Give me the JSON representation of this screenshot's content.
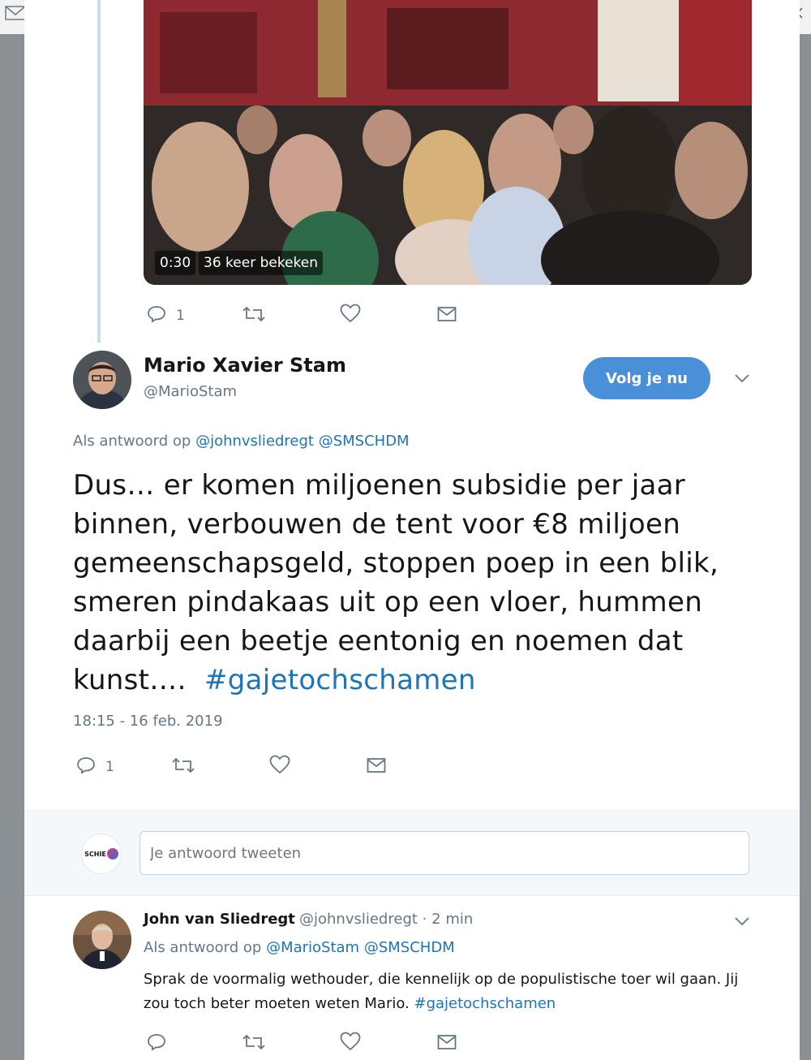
{
  "main_tweet": {
    "author_name": "Mario Xavier Stam",
    "author_handle": "@MarioStam",
    "follow_label": "Volg je nu",
    "reply_prefix": "Als antwoord op",
    "reply_mentions": "@johnvsliedregt @SMSCHDM",
    "text": "Dus… er komen miljoenen subsidie per jaar binnen, verbouwen de tent voor €8 miljoen gemeenschapsgeld, stoppen poep in een blik, smeren pindakaas uit op een vloer, hummen daarbij een beetje eentonig en noemen dat kunst….",
    "hashtag": "#gajetochschamen",
    "timestamp": "18:15 - 16 feb. 2019",
    "reply_count": "1"
  },
  "video_tweet": {
    "duration": "0:30",
    "views": "36 keer bekeken",
    "reply_count": "1"
  },
  "reply_box": {
    "placeholder": "Je antwoord tweeten",
    "avatar_label": "SCHIE"
  },
  "reply_tweet": {
    "author_name": "John van Sliedregt",
    "author_handle": "@johnvsliedregt",
    "separator": "·",
    "time_ago": "2 min",
    "reply_prefix": "Als antwoord op",
    "mention_1": "@MarioStam",
    "mention_2": "@SMSCHDM",
    "text": "Sprak de voormalig wethouder, die kennelijk op de populistische toer wil gaan. Jij zou toch beter moeten weten Mario.",
    "hashtag": "#gajetochschamen"
  },
  "icons": [
    "reply-icon",
    "retweet-icon",
    "like-icon",
    "message-icon",
    "chevron-down-icon",
    "mail-icon",
    "close-icon"
  ],
  "colors": {
    "link": "#1b75bb",
    "follow_button": "#4a90d9",
    "muted": "#657786",
    "thread_line": "#c4dff0"
  }
}
